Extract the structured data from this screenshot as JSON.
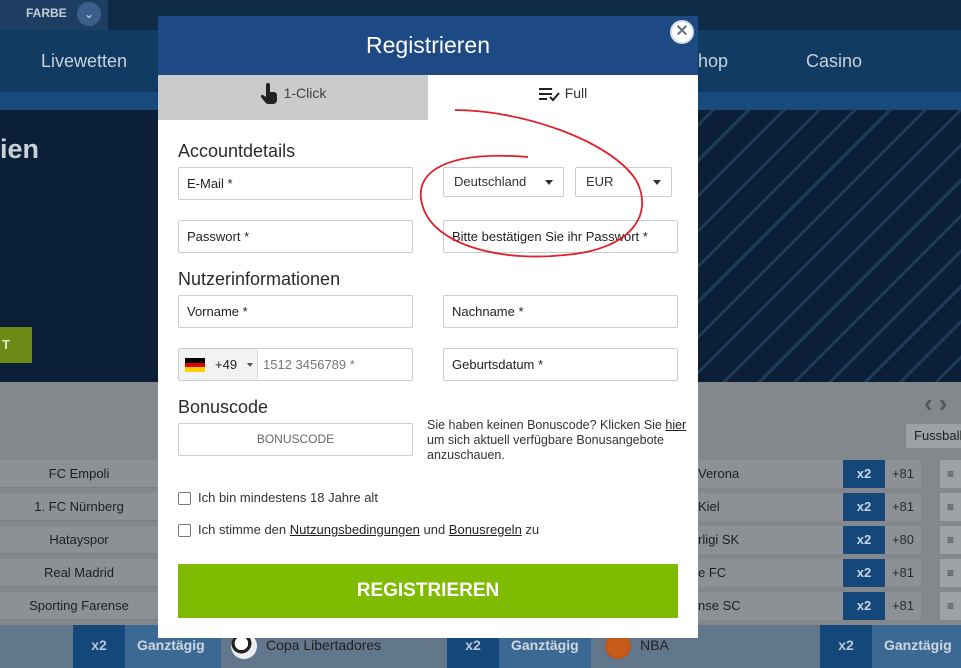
{
  "header": {
    "farbe_label": "FARBE"
  },
  "nav": {
    "items": [
      "Livewetten",
      "Shop",
      "Casino"
    ]
  },
  "hero": {
    "title_partial": "ien",
    "button_partial": "T"
  },
  "sports_filter": {
    "label": "Fussball"
  },
  "matches": [
    {
      "home": "FC Empoli",
      "away": "Verona",
      "odds_label": "x2",
      "more": "+81"
    },
    {
      "home": "1. FC Nürnberg",
      "away": "Kiel",
      "odds_label": "x2",
      "more": "+81"
    },
    {
      "home": "Hatayspor",
      "away": "rligi SK",
      "odds_label": "x2",
      "more": "+80"
    },
    {
      "home": "Real Madrid",
      "away": "e FC",
      "odds_label": "x2",
      "more": "+81"
    },
    {
      "home": "Sporting Farense",
      "away": "nse SC",
      "odds_label": "x2",
      "more": "+81"
    }
  ],
  "bottom_bar": [
    {
      "x2": "x2",
      "tag": "Ganztägig",
      "competition": "Copa Libertadores"
    },
    {
      "x2": "x2",
      "tag": "Ganztägig",
      "competition": "NBA"
    },
    {
      "x2": "x2",
      "tag": "Ganztägig",
      "competition": ""
    }
  ],
  "modal": {
    "title": "Registrieren",
    "tabs": [
      "1-Click",
      "Full"
    ],
    "active_tab": "Full",
    "sections": {
      "account": "Accountdetails",
      "user": "Nutzerinformationen",
      "bonus": "Bonuscode"
    },
    "fields": {
      "email": "E-Mail *",
      "password": "Passwort *",
      "password_confirm": "Bitte bestätigen Sie ihr Passwort *",
      "first_name": "Vorname *",
      "last_name": "Nachname *",
      "birthdate": "Geburtsdatum *",
      "phone_code": "+49",
      "phone_placeholder": "1512 3456789 *",
      "bonus_placeholder": "BONUSCODE"
    },
    "selects": {
      "country": "Deutschland",
      "currency": "EUR"
    },
    "bonus_hint": {
      "before": "Sie haben keinen Bonuscode? Klicken Sie ",
      "link": "hier",
      "after": " um sich aktuell verfügbare Bonusangebote anzuschauen."
    },
    "age_check": "Ich bin mindestens 18 Jahre alt",
    "terms": {
      "prefix": "Ich stimme den ",
      "terms_link": "Nutzungsbedingungen",
      "middle": " und ",
      "bonus_link": "Bonusregeln",
      "suffix": " zu"
    },
    "submit": "REGISTRIEREN"
  },
  "colors": {
    "modal_header": "#1d4a85",
    "submit_button": "#7fbb00",
    "annotation": "#e0202a"
  }
}
